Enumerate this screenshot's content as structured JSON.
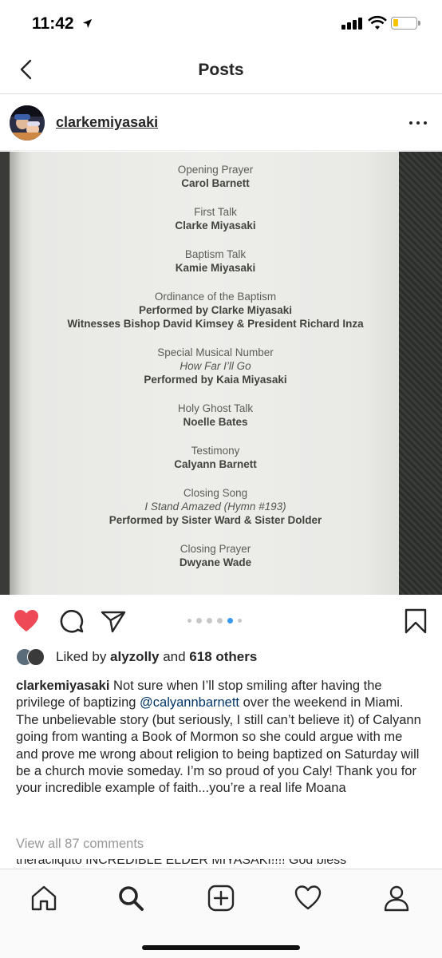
{
  "status": {
    "time": "11:42",
    "location_icon": "location-arrow-icon"
  },
  "nav": {
    "title": "Posts",
    "back_icon": "chevron-left-icon"
  },
  "post": {
    "username": "clarkemiyasaki",
    "more_icon": "more-horizontal-icon",
    "photo": {
      "program": [
        {
          "label": "Opening Prayer",
          "name": "Carol Barnett"
        },
        {
          "label": "First Talk",
          "name": "Clarke Miyasaki"
        },
        {
          "label": "Baptism Talk",
          "name": "Kamie Miyasaki"
        },
        {
          "label": "Ordinance of the Baptism",
          "name": "Performed by Clarke Miyasaki",
          "extra": "Witnesses Bishop David Kimsey & President Richard Inza"
        },
        {
          "label": "Special Musical Number",
          "italic": "How Far I’ll Go",
          "name": "Performed by Kaia Miyasaki"
        },
        {
          "label": "Holy Ghost Talk",
          "name": "Noelle Bates"
        },
        {
          "label": "Testimony",
          "name": "Calyann Barnett"
        },
        {
          "label": "Closing Song",
          "italic": "I Stand Amazed (Hymn #193)",
          "name": "Performed by Sister Ward & Sister Dolder"
        },
        {
          "label": "Closing Prayer",
          "name": "Dwyane Wade"
        }
      ]
    },
    "carousel": {
      "count": 6,
      "active_index": 4
    },
    "likes": {
      "prefix": "Liked by ",
      "user": "alyzolly",
      "middle": " and ",
      "others": "618 others"
    },
    "caption": {
      "user": "clarkemiyasaki",
      "text_before": " Not sure when I’ll stop smiling after having the privilege of baptizing ",
      "mention": "@calyannbarnett",
      "text_after": " over the weekend in Miami. The unbelievable story (but seriously, I still can’t believe it) of Calyann going from wanting a Book of Mormon so she could argue with me and prove me wrong about religion to being baptized on Saturday will be a church movie someday. I’m so proud of you Caly! Thank you for your incredible example of faith...you’re a real life Moana"
    },
    "view_comments": "View all 87 comments",
    "comment_peek": "theracliquto INCREDIBLE ELDER MIYASAKI!!!! God bless"
  },
  "colors": {
    "like_red": "#ed4956",
    "mention_blue": "#003569",
    "active_dot": "#3897f0"
  },
  "tabs": [
    {
      "name": "home",
      "icon": "home-icon"
    },
    {
      "name": "search",
      "icon": "search-icon"
    },
    {
      "name": "new-post",
      "icon": "plus-square-icon"
    },
    {
      "name": "activity",
      "icon": "heart-icon"
    },
    {
      "name": "profile",
      "icon": "user-icon"
    }
  ]
}
